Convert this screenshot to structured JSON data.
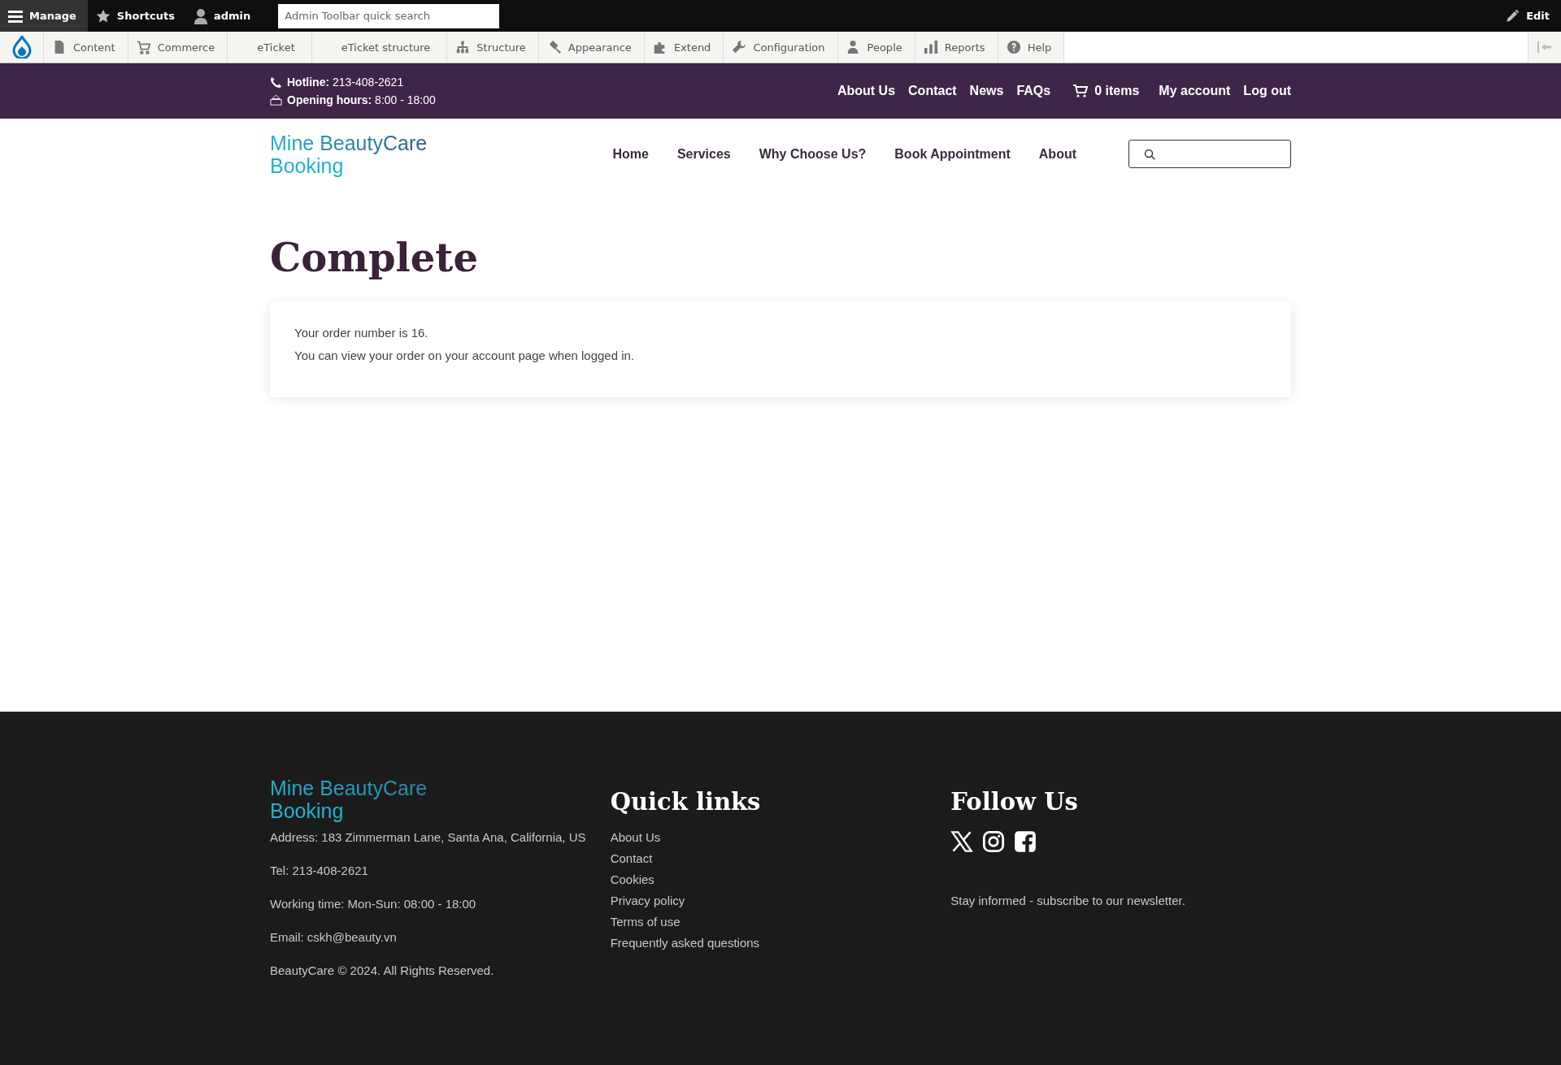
{
  "admin_toolbar": {
    "manage": "Manage",
    "shortcuts": "Shortcuts",
    "user": "admin",
    "search": {
      "placeholder": "Admin Toolbar quick search"
    },
    "edit": "Edit"
  },
  "admin_menu": [
    {
      "label": "Content"
    },
    {
      "label": "Commerce"
    },
    {
      "label": "eTicket"
    },
    {
      "label": "eTicket structure"
    },
    {
      "label": "Structure"
    },
    {
      "label": "Appearance"
    },
    {
      "label": "Extend"
    },
    {
      "label": "Configuration"
    },
    {
      "label": "People"
    },
    {
      "label": "Reports"
    },
    {
      "label": "Help"
    }
  ],
  "topbar": {
    "hotline_label": "Hotline:",
    "hotline": "213-408-2621",
    "hours_label": "Opening hours:",
    "hours": "8:00 - 18:00",
    "links": [
      "About Us",
      "Contact",
      "News",
      "FAQs"
    ],
    "cart": "0 items",
    "account_links": [
      "My account",
      "Log out"
    ]
  },
  "header": {
    "logo": [
      "Mine BeautyCare",
      "Booking"
    ],
    "nav": [
      "Home",
      "Services",
      "Why Choose Us?",
      "Book Appointment",
      "About"
    ]
  },
  "page": {
    "title": "Complete",
    "lines": [
      "Your order number is 16.",
      "You can view your order on your account page when logged in."
    ]
  },
  "footer": {
    "logo": [
      "Mine BeautyCare",
      "Booking"
    ],
    "info": [
      "Address: 183 Zimmerman Lane, Santa Ana, California, US",
      "Tel: 213-408-2621",
      "Working time: Mon-Sun: 08:00 - 18:00",
      "Email: cskh@beauty.vn",
      "BeautyCare © 2024. All Rights Reserved."
    ],
    "quick_links_title": "Quick links",
    "quick_links": [
      "About Us",
      "Contact",
      "Cookies",
      "Privacy policy",
      "Terms of use",
      "Frequently asked questions"
    ],
    "follow_title": "Follow Us",
    "newsletter": "Stay informed - subscribe to our newsletter."
  }
}
